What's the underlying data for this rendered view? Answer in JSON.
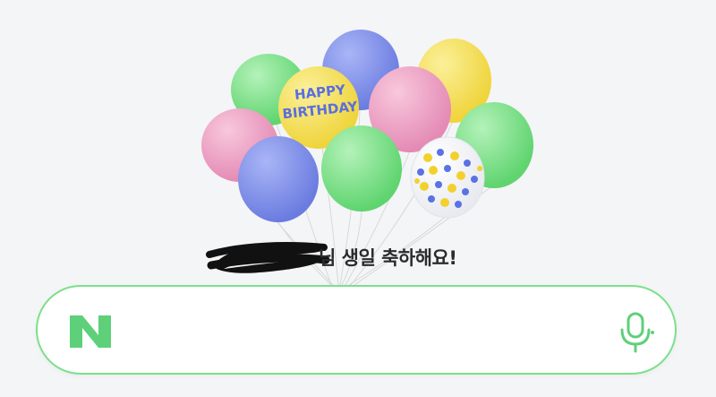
{
  "illustration": {
    "balloon_text_line1": "HAPPY",
    "balloon_text_line2": "BIRTHDAY"
  },
  "greeting": {
    "text": "님 생일 축하해요!"
  },
  "search": {
    "logo_text": "N",
    "value": "",
    "placeholder": ""
  },
  "colors": {
    "accent": "#5ed07a",
    "balloon_blue": "#7b8ce8",
    "balloon_green": "#7ee08a",
    "balloon_pink": "#ee9fc4",
    "balloon_yellow": "#f6e05a"
  },
  "icons": {
    "logo": "naver-n-icon",
    "voice": "microphone-icon"
  }
}
